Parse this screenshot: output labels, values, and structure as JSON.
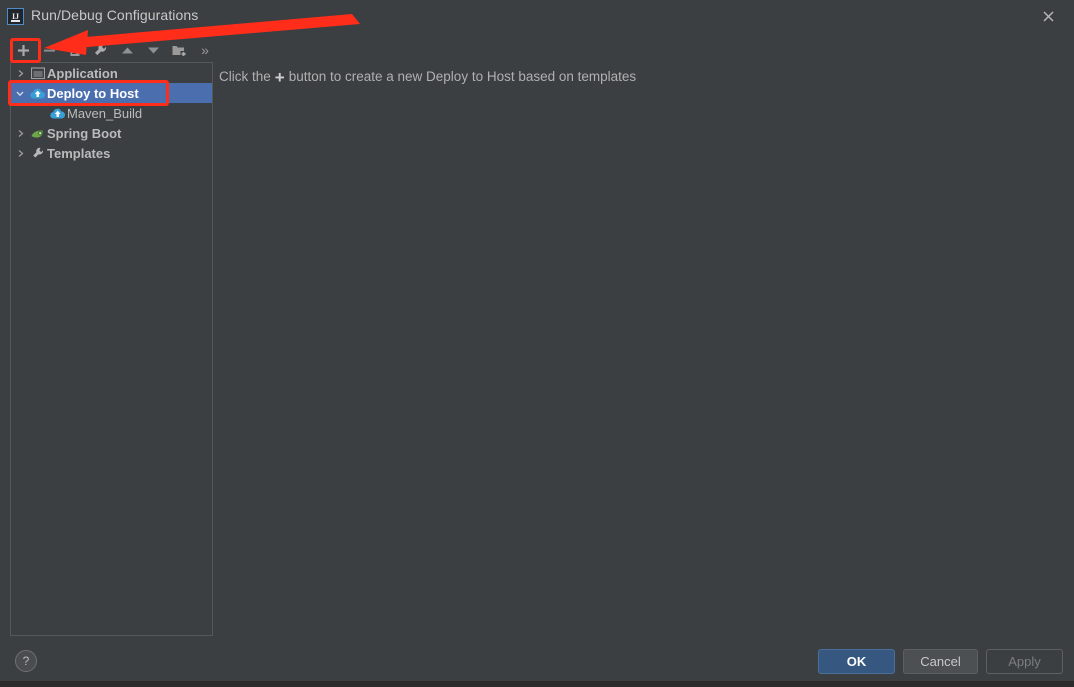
{
  "window": {
    "title": "Run/Debug Configurations",
    "app_icon": "intellij-idea-icon",
    "close_label": "✕"
  },
  "toolbar": {
    "items": [
      {
        "name": "add-configuration-button",
        "icon": "plus-icon",
        "label": "+",
        "tooltip": "Add New Configuration"
      },
      {
        "name": "remove-configuration-button",
        "icon": "minus-icon",
        "label": "−",
        "tooltip": "Remove Configuration"
      },
      {
        "name": "copy-configuration-button",
        "icon": "copy-icon",
        "label": "",
        "tooltip": "Copy Configuration"
      },
      {
        "name": "edit-templates-button",
        "icon": "wrench-icon",
        "label": "",
        "tooltip": "Edit Templates"
      },
      {
        "name": "move-up-button",
        "icon": "triangle-up-icon",
        "label": "",
        "tooltip": "Move Up"
      },
      {
        "name": "move-down-button",
        "icon": "triangle-down-icon",
        "label": "",
        "tooltip": "Move Down"
      },
      {
        "name": "new-folder-button",
        "icon": "folder-add-icon",
        "label": "",
        "tooltip": "Create New Folder"
      },
      {
        "name": "overflow-button",
        "icon": "chevron-double-right-icon",
        "label": "»",
        "tooltip": "More"
      }
    ]
  },
  "tree": {
    "nodes": [
      {
        "label": "Application",
        "icon": "application-icon",
        "twisty": "collapsed",
        "level": 1,
        "selected": false,
        "bold": true
      },
      {
        "label": "Deploy to Host",
        "icon": "deploy-cloud-icon",
        "twisty": "expanded",
        "level": 1,
        "selected": true,
        "bold": true
      },
      {
        "label": "Maven_Build",
        "icon": "deploy-cloud-icon",
        "twisty": "none",
        "level": 2,
        "selected": false,
        "bold": false
      },
      {
        "label": "Spring Boot",
        "icon": "spring-boot-icon",
        "twisty": "collapsed",
        "level": 1,
        "selected": false,
        "bold": true
      },
      {
        "label": "Templates",
        "icon": "wrench-icon",
        "twisty": "collapsed",
        "level": 1,
        "selected": false,
        "bold": true
      }
    ]
  },
  "content": {
    "hint_before": "Click the",
    "hint_plus": "+",
    "hint_after": "button to create a new Deploy to Host based on templates"
  },
  "footer": {
    "help_label": "?",
    "ok_label": "OK",
    "cancel_label": "Cancel",
    "apply_label": "Apply"
  },
  "annotations": {
    "highlight_color": "#ff2d1a",
    "boxes": [
      {
        "name": "add-button-highlight",
        "target": "add-configuration-button"
      },
      {
        "name": "deploy-to-host-highlight",
        "target": "tree-node-deploy-to-host"
      }
    ],
    "arrow": {
      "name": "pointer-arrow",
      "from": "top-right",
      "to": "add-configuration-button"
    }
  },
  "colors": {
    "background": "#3c3f41",
    "selection": "#4b6eaf",
    "ok_button": "#365880",
    "text": "#bbbbbb",
    "border": "#555759"
  }
}
